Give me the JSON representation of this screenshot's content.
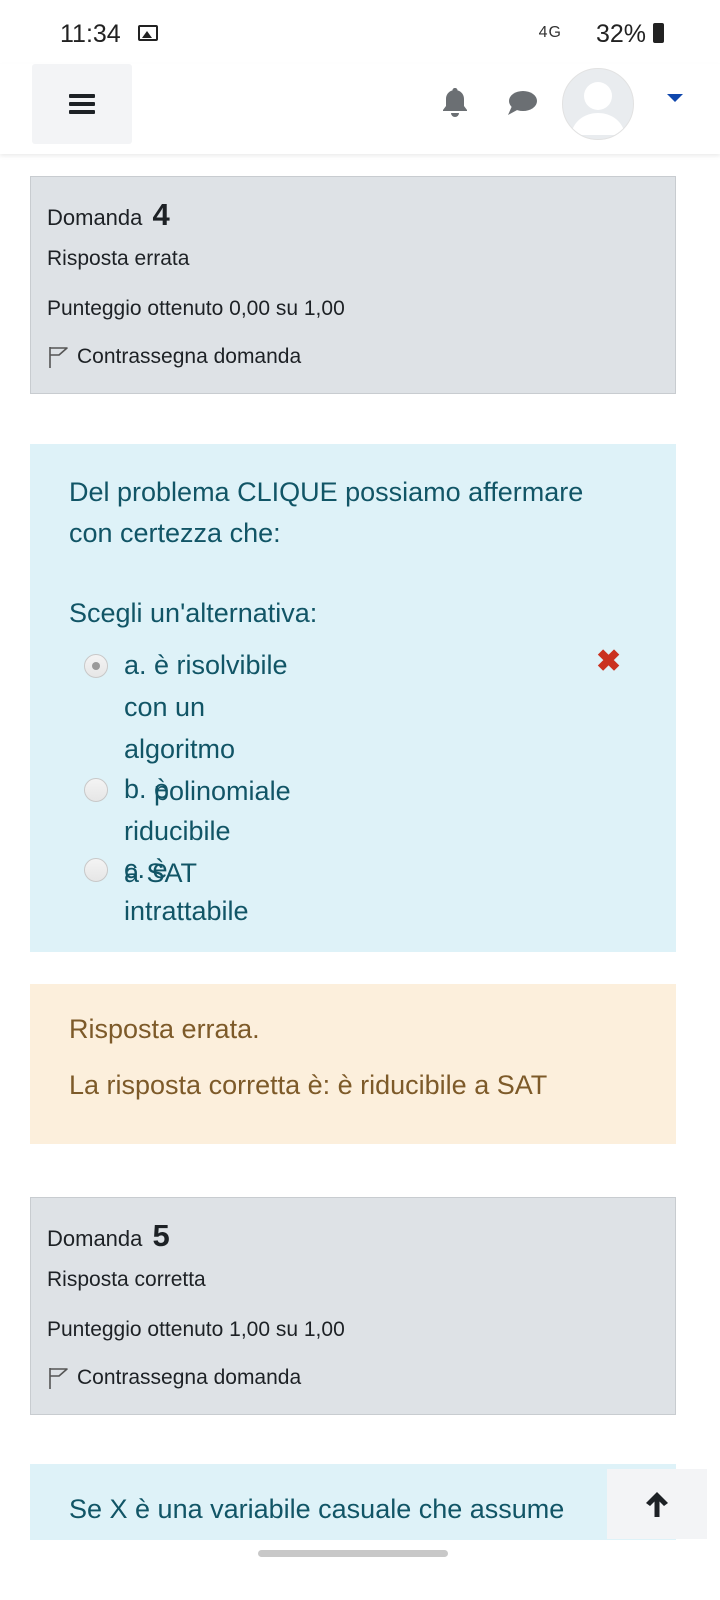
{
  "status_bar": {
    "time": "11:34",
    "network": "4G",
    "battery": "32%"
  },
  "questions": [
    {
      "label": "Domanda",
      "number": "4",
      "state": "Risposta errata",
      "grade": "Punteggio ottenuto 0,00 su 1,00",
      "flag": "Contrassegna domanda"
    },
    {
      "label": "Domanda",
      "number": "5",
      "state": "Risposta corretta",
      "grade": "Punteggio ottenuto 1,00 su 1,00",
      "flag": "Contrassegna domanda"
    }
  ],
  "q4": {
    "prompt": "Del problema CLIQUE possiamo affermare con certezza che:",
    "choose": "Scegli un'alternativa:",
    "options": [
      {
        "line1": "a. è risolvibile con un algoritmo",
        "line2": "polinomiale",
        "selected": true,
        "mark": "✖"
      },
      {
        "line1": "b. è riducibile a SAT",
        "selected": false
      },
      {
        "line1": "c. è intrattabile",
        "selected": false
      }
    ],
    "feedback": {
      "result": "Risposta errata.",
      "correct": "La risposta corretta è: è riducibile a SAT"
    }
  },
  "q5_preview": "Se X è una variabile casuale che assume",
  "colors": {
    "info_bg": "#dee2e6",
    "question_bg": "#def2f8",
    "question_text": "#115566",
    "feedback_bg": "#fcefdc",
    "feedback_text": "#7d5a29",
    "wrong_mark": "#ca3120",
    "caret": "#0f47ad"
  },
  "icons": [
    "menu-icon",
    "bell-icon",
    "chat-icon",
    "avatar-icon",
    "dropdown-caret-icon",
    "flag-icon",
    "wrong-mark-icon",
    "arrow-up-icon",
    "image-icon"
  ]
}
